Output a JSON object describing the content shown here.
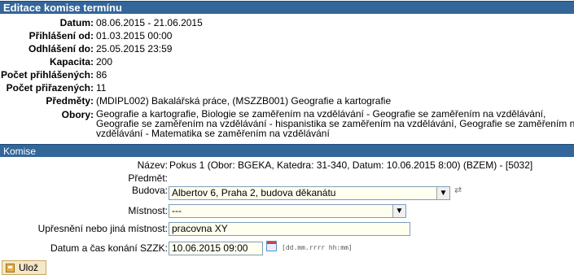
{
  "header": {
    "title": "Editace komise termínu"
  },
  "details": [
    {
      "label": "Datum:",
      "value": "08.06.2015 - 21.06.2015"
    },
    {
      "label": "Přihlášení od:",
      "value": "01.03.2015 00:00"
    },
    {
      "label": "Odhlášení do:",
      "value": "25.05.2015 23:59"
    },
    {
      "label": "Kapacita:",
      "value": "200"
    },
    {
      "label": "Počet přihlášených:",
      "value": "86"
    },
    {
      "label": "Počet přiřazených:",
      "value": "11"
    },
    {
      "label": "Předměty:",
      "value": "(MDIPL002) Bakalářská práce, (MSZZB001) Geografie a kartografie"
    }
  ],
  "obory": {
    "label": "Obory:",
    "value": "Geografie a kartografie, Biologie se zaměřením na vzdělávání - Geografie se zaměřením na vzdělávání, Geografie se zaměřením na vzdělávání - hispanistika se zaměřením na vzdělávání, Geografie se zaměřením na vzdělávání - Matematika se zaměřením na vzdělávání"
  },
  "komise": {
    "title": "Komise",
    "nazev_label": "Název:",
    "nazev_value": "Pokus 1 (Obor: BGEKA, Katedra: 31-340, Datum: 10.06.2015 8:00) (BZEM) - [5032]",
    "predmet_label": "Předmět:",
    "predmet_value": "",
    "budova_label": "Budova:",
    "budova_value": "Albertov 6, Praha 2, budova děkanátu",
    "mistnost_label": "Místnost:",
    "mistnost_value": "---",
    "upresneni_label": "Upřesnění nebo jiná místnost:",
    "upresneni_value": "pracovna XY",
    "datum_label": "Datum a čas konání SZZK:",
    "datum_value": "10.06.2015 09:00",
    "datum_hint": "[dd.mm.rrrr hh:mm]"
  },
  "actions": {
    "save_label": "Ulož"
  }
}
